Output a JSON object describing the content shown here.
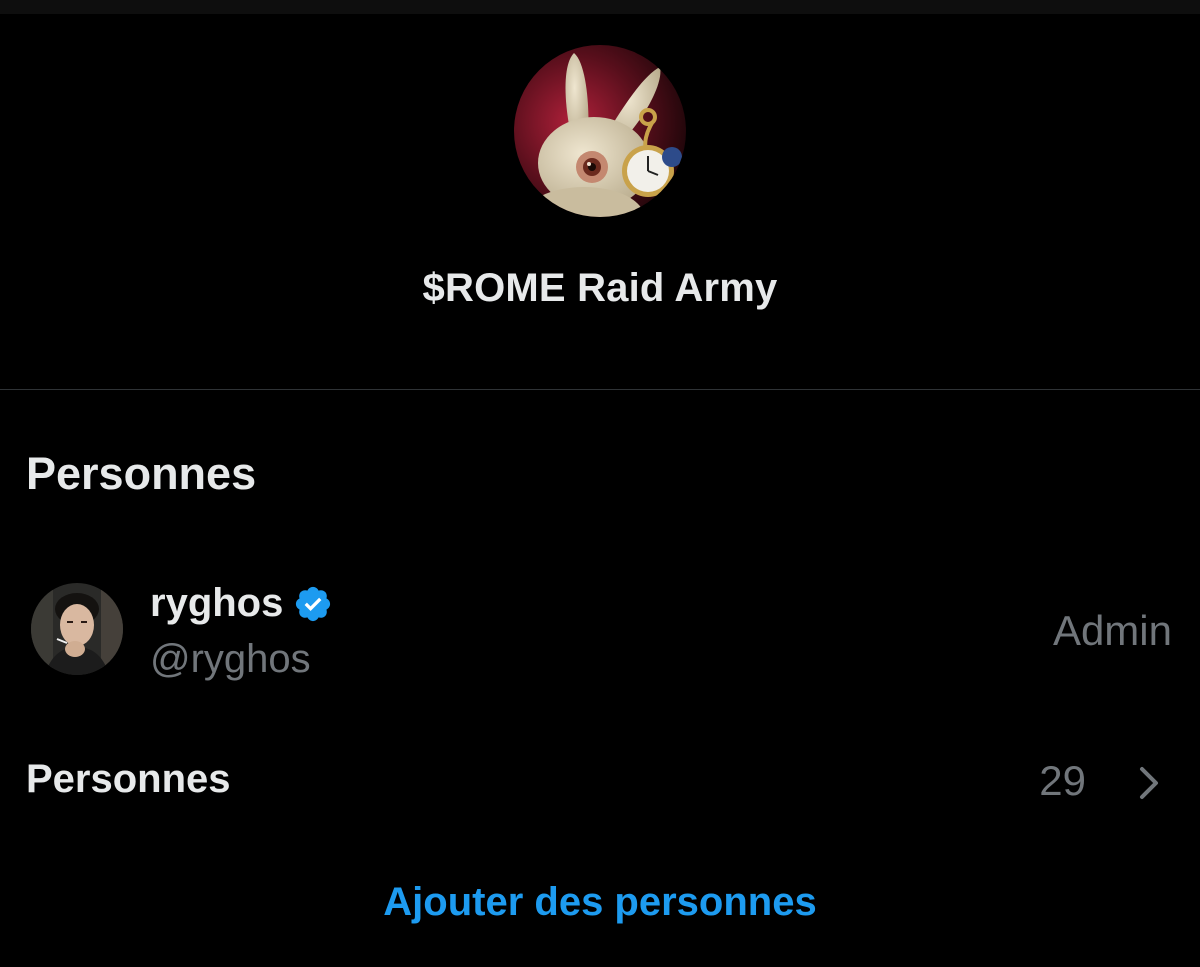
{
  "group": {
    "title": "$ROME Raid Army",
    "avatar": "white-rabbit-with-pocket-watch"
  },
  "people_section": {
    "heading": "Personnes",
    "members": [
      {
        "name": "ryghos",
        "handle": "@ryghos",
        "role": "Admin",
        "verified": true,
        "avatar": "man-portrait"
      }
    ]
  },
  "people_row": {
    "label": "Personnes",
    "count": "29",
    "icon": "chevron-right-icon"
  },
  "actions": {
    "add_people_label": "Ajouter des personnes"
  },
  "colors": {
    "background": "#000000",
    "primary_text": "#e7e9ea",
    "secondary_text": "#71767b",
    "accent": "#1d9bf0",
    "divider": "#2f3336"
  }
}
